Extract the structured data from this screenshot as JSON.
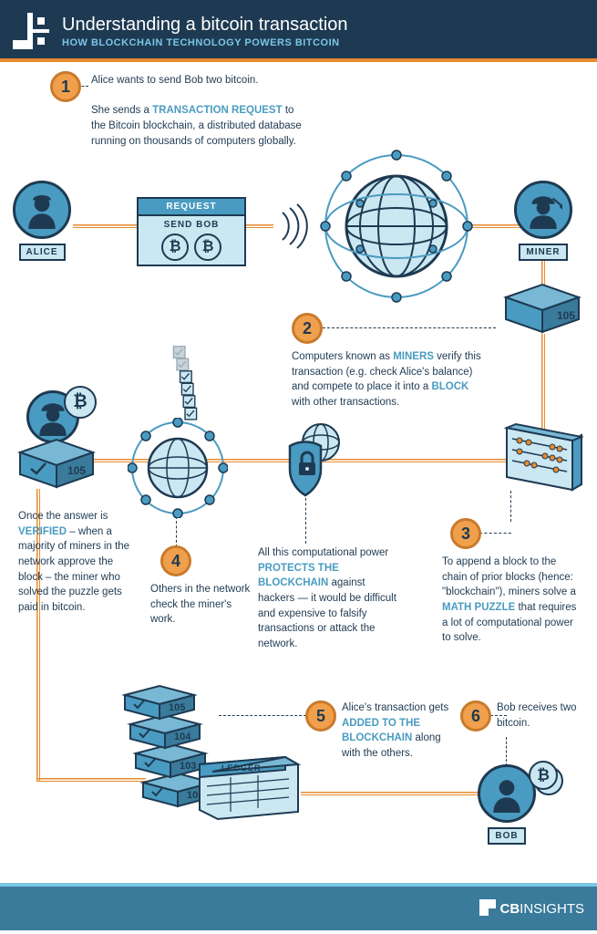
{
  "header": {
    "title": "Understanding a bitcoin transaction",
    "subtitle": "HOW BLOCKCHAIN TECHNOLOGY POWERS BITCOIN"
  },
  "steps": {
    "s1": {
      "num": "1",
      "line1": "Alice wants to send Bob two bitcoin.",
      "line2a": "She sends a ",
      "line2b": "TRANSACTION REQUEST",
      "line2c": " to the Bitcoin blockchain, a distributed database running on thousands of computers globally."
    },
    "s2": {
      "num": "2",
      "a": "Computers known as ",
      "b": "MINERS",
      "c": " verify this transaction (e.g. check Alice's balance) and compete to place it into a ",
      "d": "BLOCK",
      "e": " with other transactions."
    },
    "s3": {
      "num": "3",
      "a": "To append a block to the chain of prior blocks (hence: \"blockchain\"), miners solve a ",
      "b": "MATH PUZZLE",
      "c": " that requires a lot of computational power to solve."
    },
    "s3x": {
      "a": "All this computational power ",
      "b": "PROTECTS THE BLOCKCHAIN",
      "c": " against hackers — it would be difficult and expensive to falsify transactions or attack the network."
    },
    "s4": {
      "num": "4",
      "a": "Others in the network check the miner's work."
    },
    "s4x": {
      "a": "Once the answer is ",
      "b": "VERIFIED",
      "c": " – when a majority of miners in the network approve the block – the miner who solved the puzzle gets paid in bitcoin."
    },
    "s5": {
      "num": "5",
      "a": "Alice's transaction gets ",
      "b": "ADDED TO THE BLOCKCHAIN",
      "c": " along with the others."
    },
    "s6": {
      "num": "6",
      "a": "Bob receives two bitcoin."
    }
  },
  "labels": {
    "alice": "ALICE",
    "miner": "MINER",
    "bob": "BOB",
    "request": "REQUEST",
    "sendbob": "SEND BOB",
    "ledger": "LEDGER"
  },
  "blocks": {
    "b105": "105",
    "b104": "104",
    "b103": "103",
    "b102": "102"
  },
  "footer": {
    "brand_prefix": "CB",
    "brand_suffix": "INSIGHTS"
  }
}
